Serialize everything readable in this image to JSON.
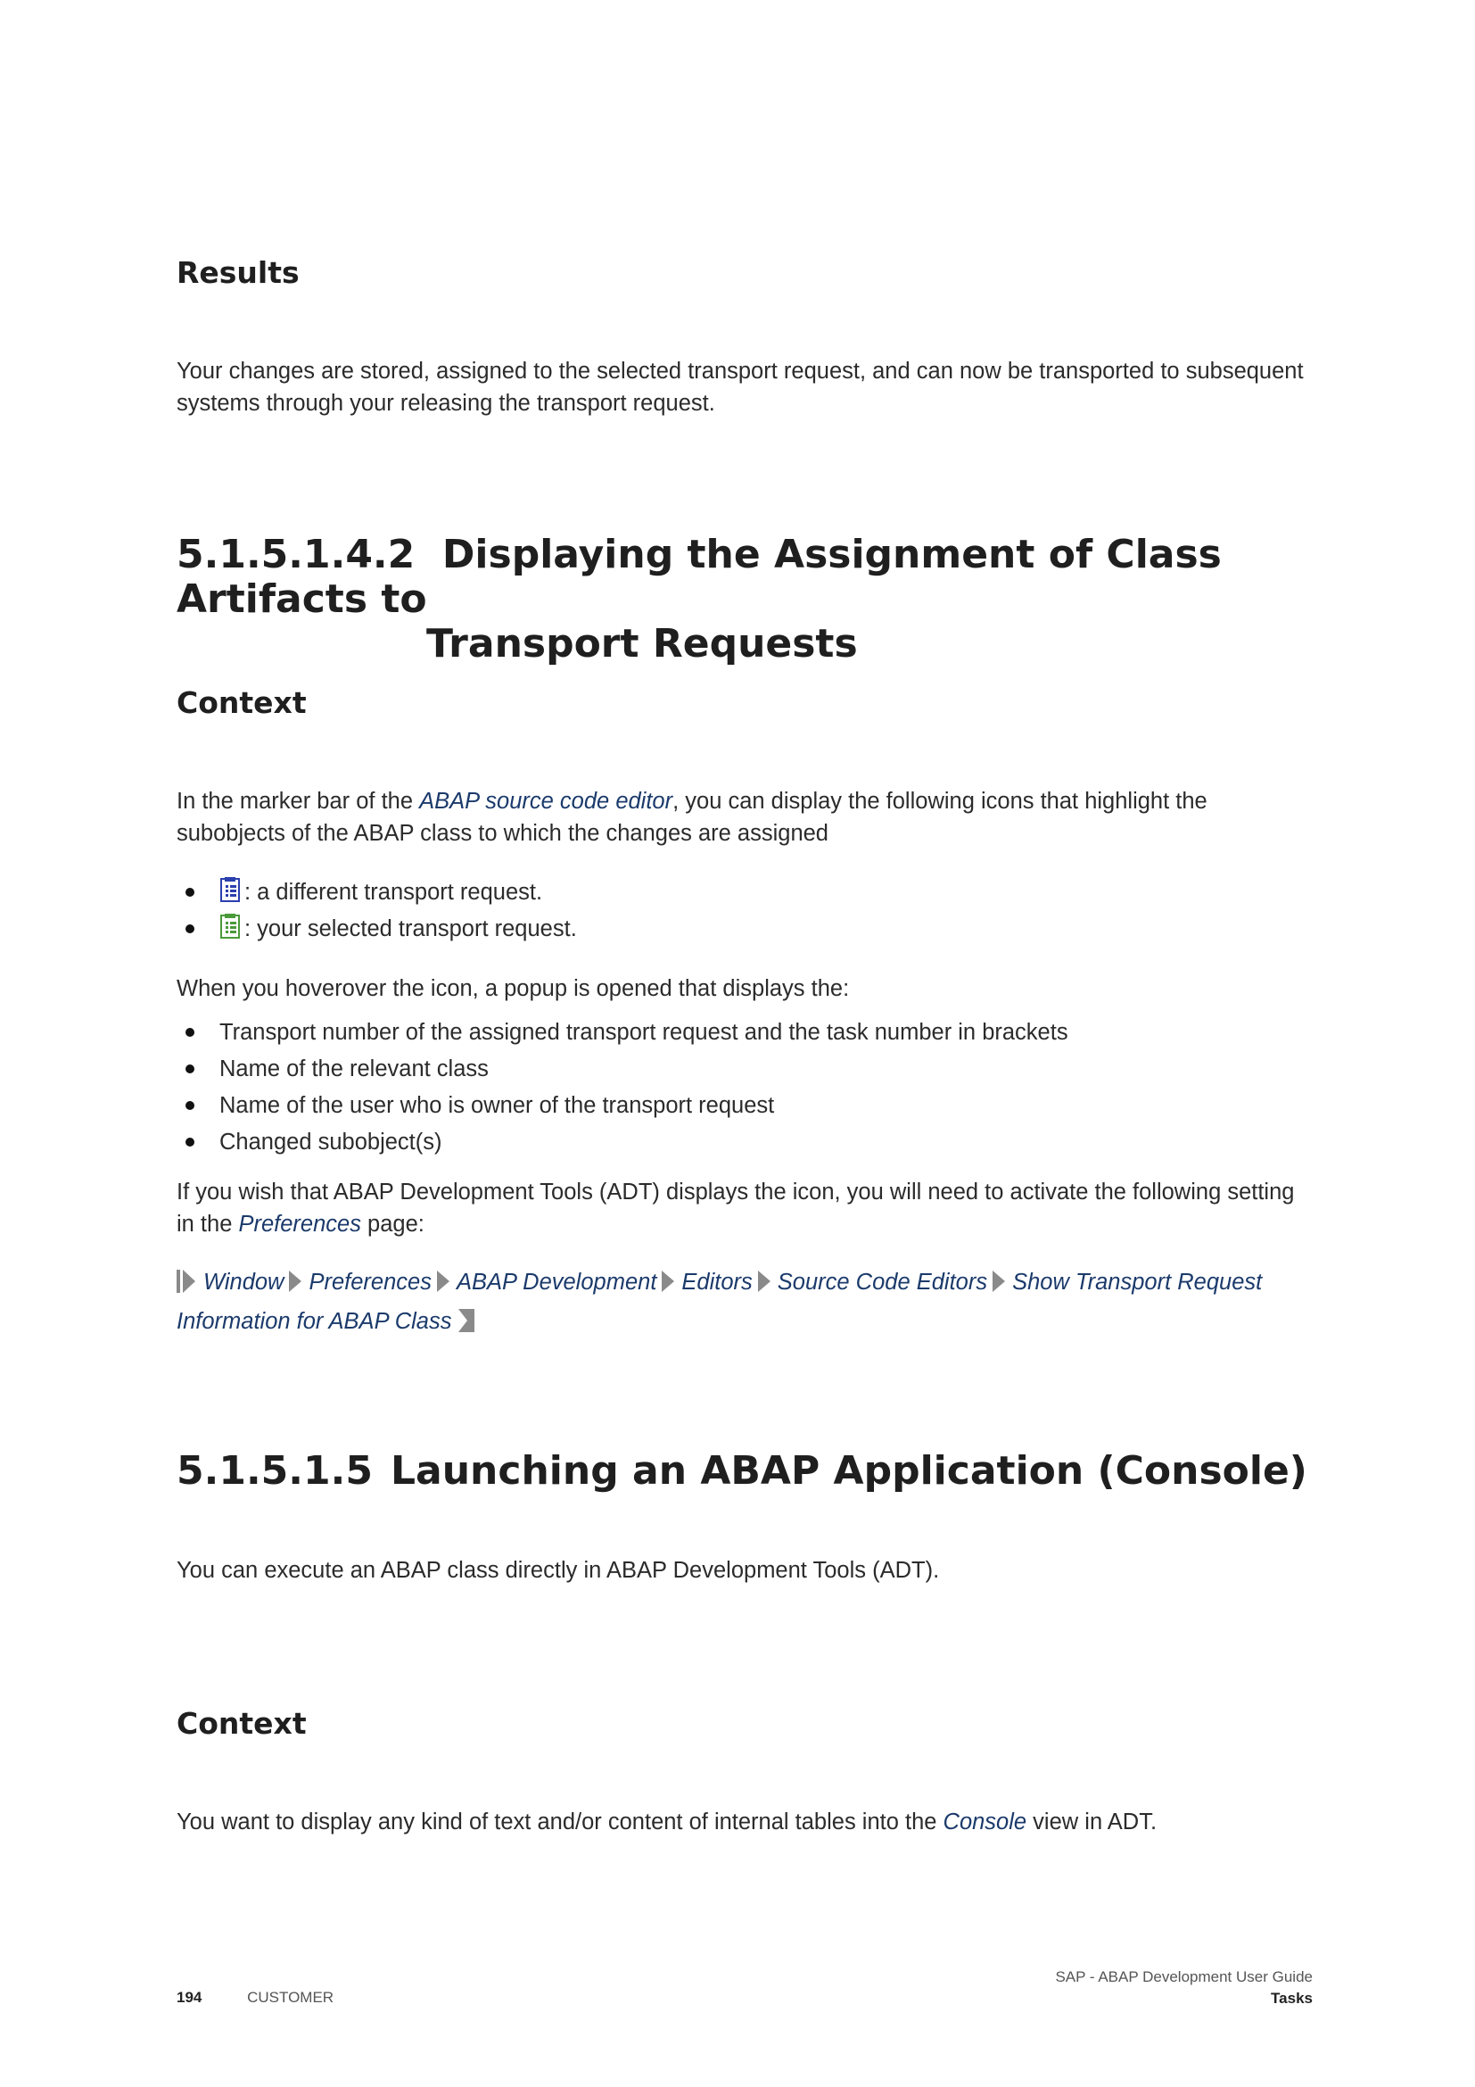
{
  "results": {
    "heading": "Results",
    "text": "Your changes are stored, assigned to the selected transport request, and can now be transported to subsequent systems through your releasing the transport request."
  },
  "section1": {
    "number": "5.1.5.1.4.2",
    "title_line1": "Displaying the Assignment of Class Artifacts to",
    "title_line2": "Transport Requests",
    "context_heading": "Context",
    "intro_before": "In the marker bar of the ",
    "intro_link": "ABAP source code editor",
    "intro_after": ", you can display the following icons that highlight the subobjects of the ABAP class to which the changes are assigned",
    "icon_items": [
      {
        "icon": "blue-transport-request-icon",
        "text": ": a different transport request."
      },
      {
        "icon": "green-transport-request-icon",
        "text": ": your selected transport request."
      }
    ],
    "hover_text": "When you hoverover the icon, a popup is opened that displays the:",
    "popup_items": [
      "Transport number of the assigned transport request and the task number in brackets",
      "Name of the relevant class",
      "Name of the user who is owner of the transport request",
      "Changed subobject(s)"
    ],
    "setting_before": "If you wish that ABAP Development Tools (ADT) displays the icon, you will need to activate the following setting in the ",
    "setting_link": "Preferences",
    "setting_after": " page:",
    "menu_path": [
      "Window",
      "Preferences",
      "ABAP Development",
      "Editors",
      "Source Code Editors",
      "Show Transport Request Information for ABAP Class"
    ]
  },
  "section2": {
    "number": "5.1.5.1.5",
    "title": "Launching an ABAP Application (Console)",
    "text": "You can execute an ABAP class directly in ABAP Development Tools (ADT).",
    "context_heading": "Context",
    "context_before": "You want to display any kind of text and/or content of internal tables into the ",
    "context_link": "Console",
    "context_after": " view in ADT."
  },
  "footer": {
    "page_number": "194",
    "classification": "CUSTOMER",
    "guide_title": "SAP - ABAP Development User Guide",
    "chapter": "Tasks"
  },
  "colors": {
    "link": "#1b3a6b",
    "chevron": "#8a8a8a"
  }
}
